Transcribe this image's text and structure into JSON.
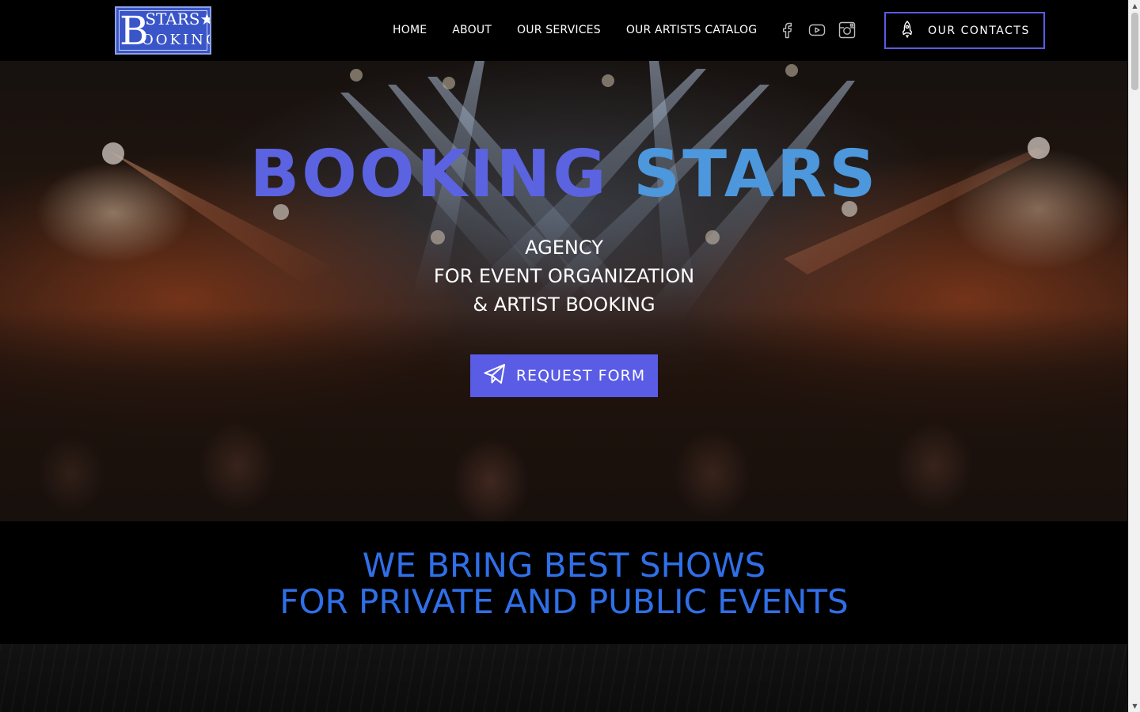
{
  "header": {
    "logo": {
      "line1": "STARS",
      "line2": "OOKING",
      "letter": "B"
    },
    "nav": [
      {
        "label": "HOME"
      },
      {
        "label": "ABOUT"
      },
      {
        "label": "OUR SERVICES"
      },
      {
        "label": "OUR ARTISTS CATALOG"
      }
    ],
    "social": [
      "facebook-icon",
      "youtube-icon",
      "instagram-icon"
    ],
    "contacts_label": "OUR CONTACTS"
  },
  "hero": {
    "title_word1": "BOOKING",
    "title_word2": "STARS",
    "subtitle": [
      "AGENCY",
      "FOR EVENT ORGANIZATION",
      "& ARTIST BOOKING"
    ],
    "request_label": "REQUEST FORM"
  },
  "tagline": {
    "line1": "WE BRING BEST SHOWS",
    "line2": "FOR PRIVATE AND PUBLIC EVENTS"
  },
  "colors": {
    "accent": "#5a5ce6",
    "title_blue": "#5b63e0",
    "title_light_blue": "#4d97dc",
    "tagline_blue": "#2f6fe8"
  }
}
